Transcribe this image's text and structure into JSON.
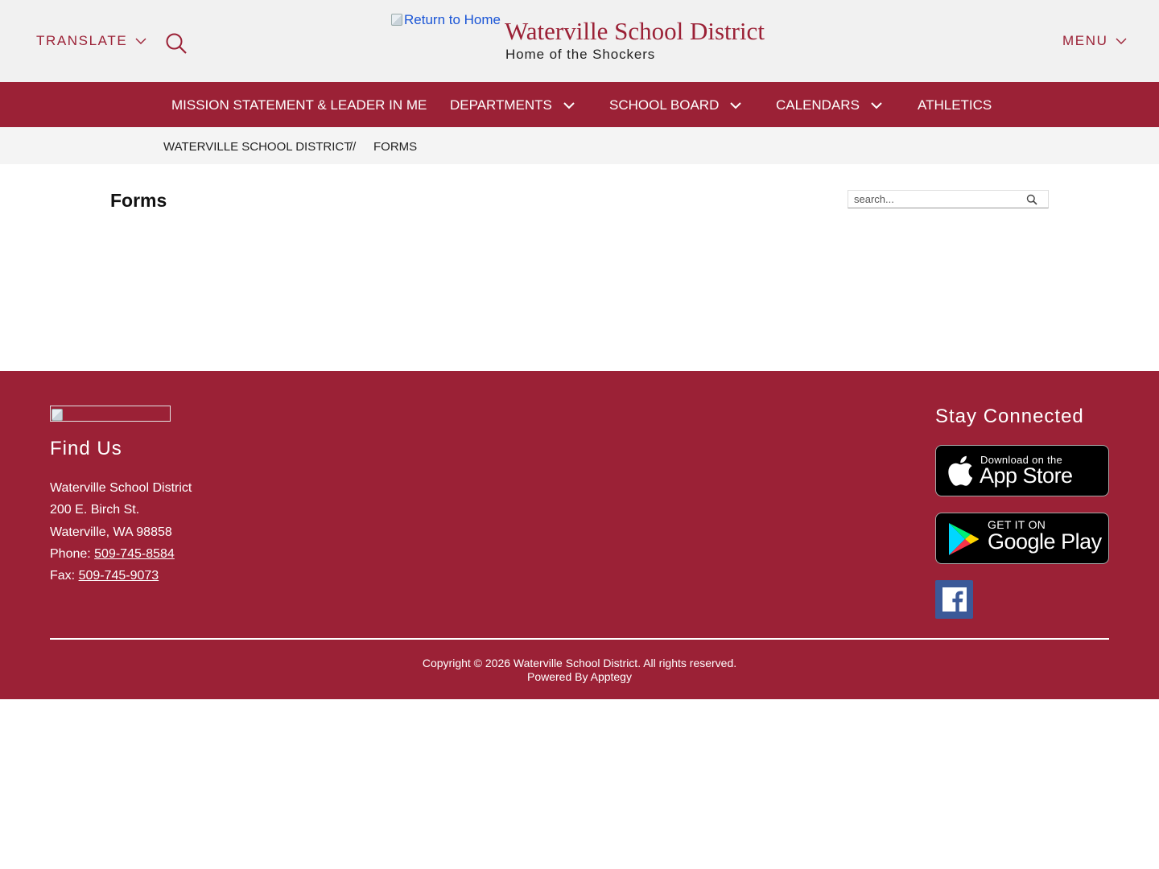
{
  "header": {
    "translate_label": "TRANSLATE",
    "logo_alt": "Return to Home",
    "site_title": "Waterville School District",
    "site_subtitle": "Home of the Shockers",
    "menu_label": "MENU"
  },
  "nav": {
    "items": [
      {
        "label": "MISSION STATEMENT & LEADER IN ME",
        "has_dropdown": false
      },
      {
        "label": "DEPARTMENTS",
        "has_dropdown": true
      },
      {
        "label": "SCHOOL BOARD",
        "has_dropdown": true
      },
      {
        "label": "CALENDARS",
        "has_dropdown": true
      },
      {
        "label": "ATHLETICS",
        "has_dropdown": false
      }
    ]
  },
  "breadcrumb": {
    "home": "WATERVILLE SCHOOL DISTRICT",
    "separator": "//",
    "current": "FORMS"
  },
  "main": {
    "title": "Forms",
    "search_placeholder": "search..."
  },
  "footer": {
    "find_us_heading": "Find Us",
    "address_name": "Waterville School District",
    "address_street": "200 E. Birch St.",
    "address_city": "Waterville, WA 98858",
    "phone_label": "Phone: ",
    "phone": "509-745-8584",
    "fax_label": "Fax: ",
    "fax": "509-745-9073",
    "stay_connected_heading": "Stay Connected",
    "app_store_small": "Download on the",
    "app_store_big": "App Store",
    "google_play_small": "GET IT ON",
    "google_play_big": "Google Play",
    "copyright": "Copyright © 2026 Waterville School District. All rights reserved.",
    "powered_by": "Powered By Apptegy"
  },
  "colors": {
    "brand": "#9b2136",
    "header_bg": "#f1f1f1",
    "breadcrumb_bg": "#f4f4f4",
    "facebook": "#3b5998"
  }
}
